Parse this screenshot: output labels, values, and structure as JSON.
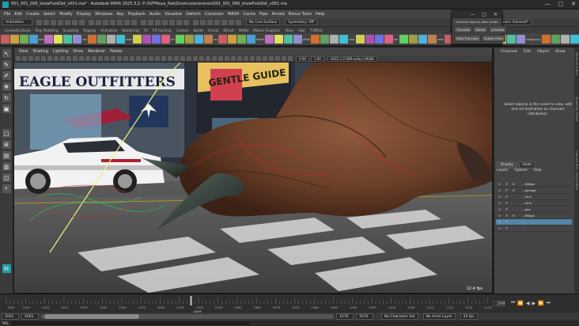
{
  "window": {
    "title": "001_001_006_showFootDet_v001.ma* - Autodesk MAYA 2025.3.2: P:/SVFMaya_Nat/Gnomuzes/scenes/001_001_006_showFootDet_v001.ma",
    "controls": [
      "—",
      "□",
      "✕"
    ]
  },
  "menubar": [
    "File",
    "Edit",
    "Create",
    "Select",
    "Modify",
    "Display",
    "Windows",
    "Key",
    "Playback",
    "Audio",
    "Visualize",
    "Deform",
    "Constrain",
    "MASH",
    "Cache",
    "Pipe",
    "Arnold",
    "Bonus Tools",
    "Help"
  ],
  "statusline": {
    "mode": "Animation",
    "surface": "No Live Surface",
    "symmetry": "Symmetry: Off",
    "workspace": "Workspace: General*"
  },
  "shelf_tabs": [
    "CurvesSurfaces",
    "Poly Modeling",
    "Sculpting",
    "Rigging",
    "Animation",
    "Rendering",
    "FX",
    "FX Caching",
    "Custom",
    "Bullet",
    "Arnold",
    "Bifrost",
    "MASH",
    "Motion Graphics",
    "XGen",
    "Hair",
    "TURTLE"
  ],
  "shelf_buttons": [
    "bbb",
    "sss",
    "anim",
    "kfr",
    "zpi",
    "aTools",
    "pDup",
    "shot",
    "kwr",
    "arlen",
    "skn",
    "toggleLock",
    "ikfk",
    "Shelf2",
    "SweepMP",
    "Slogger"
  ],
  "shelf_colors": [
    "#c86060",
    "#d0a040",
    "#70b050",
    "#4aa0d0",
    "#c070c0",
    "#e0e060",
    "#50c0a0",
    "#9090d0",
    "#d07030",
    "#60a060",
    "#b0b0b0",
    "#40c0d0",
    "#d0d050",
    "#b050b0",
    "#7070e0",
    "#e06080",
    "#60d060",
    "#a0a040",
    "#50b0e0",
    "#c08050"
  ],
  "viewport": {
    "menus": [
      "View",
      "Shading",
      "Lighting",
      "Show",
      "Renderer",
      "Panels"
    ],
    "fields": {
      "near": "0.00",
      "far": "1.00",
      "colorspace": "ACES 1.0 SDR-video (sRGB)"
    },
    "fps": "12.4 fps",
    "camera": "persp",
    "storefront": "EAGLE OUTFITTERS",
    "billboard": "GENTLE GUIDE"
  },
  "floating_window": {
    "message": "Selected objects after mode",
    "buttons": [
      "Translate",
      "Rotate",
      "unfreeze",
      "EBox Translate",
      "Rotate Order"
    ]
  },
  "channel_box": {
    "menu": [
      "Channels",
      "Edit",
      "Object",
      "Show"
    ],
    "message": "Select objects in the scene to view, edit and set keyframes on channels (attributes)."
  },
  "layer_editor": {
    "tabs": [
      "Display",
      "Anim"
    ],
    "menu": [
      "Layers",
      "Options",
      "Help"
    ],
    "layers": [
      {
        "v": "V",
        "p": "P",
        "r": "R",
        "name": "...ftBdge"
      },
      {
        "v": "V",
        "p": "P",
        "r": "R",
        "name": "...geedge"
      },
      {
        "v": "V",
        "p": "P",
        "r": "",
        "name": "...ctrls"
      },
      {
        "v": "V",
        "p": "P",
        "r": "",
        "name": "...ctrls"
      },
      {
        "v": "V",
        "p": "P",
        "r": "",
        "name": "...geo"
      },
      {
        "v": "V",
        "p": "P",
        "r": "R",
        "name": "...ftBdge"
      },
      {
        "v": "V",
        "p": "P",
        "r": "",
        "name": "..."
      },
      {
        "v": "V",
        "p": "P",
        "r": "",
        "name": "..."
      }
    ]
  },
  "side_labels": [
    "Attribute Editor",
    "Modelling Toolkit",
    "Channel Box / Layer Editor"
  ],
  "timeline": {
    "ticks": [
      "1001",
      "1005",
      "1010",
      "1015",
      "1020",
      "1025",
      "1030",
      "1035",
      "1040",
      "1045",
      "1050",
      "1055",
      "1060",
      "1065",
      "1070",
      "1075",
      "1080",
      "1085",
      "1090",
      "1095",
      "1100",
      "1105",
      "1110",
      "1115",
      "1120",
      "1125"
    ],
    "current": "1049",
    "current_frame_field": "1049"
  },
  "range": {
    "start": "1001",
    "inner_start": "1001",
    "inner_end": "1076",
    "end": "1076",
    "character_set": "No Character Set",
    "anim_layer": "No Anim Layer",
    "fps": "24 fps"
  },
  "bottom": {
    "mel": "MEL"
  }
}
